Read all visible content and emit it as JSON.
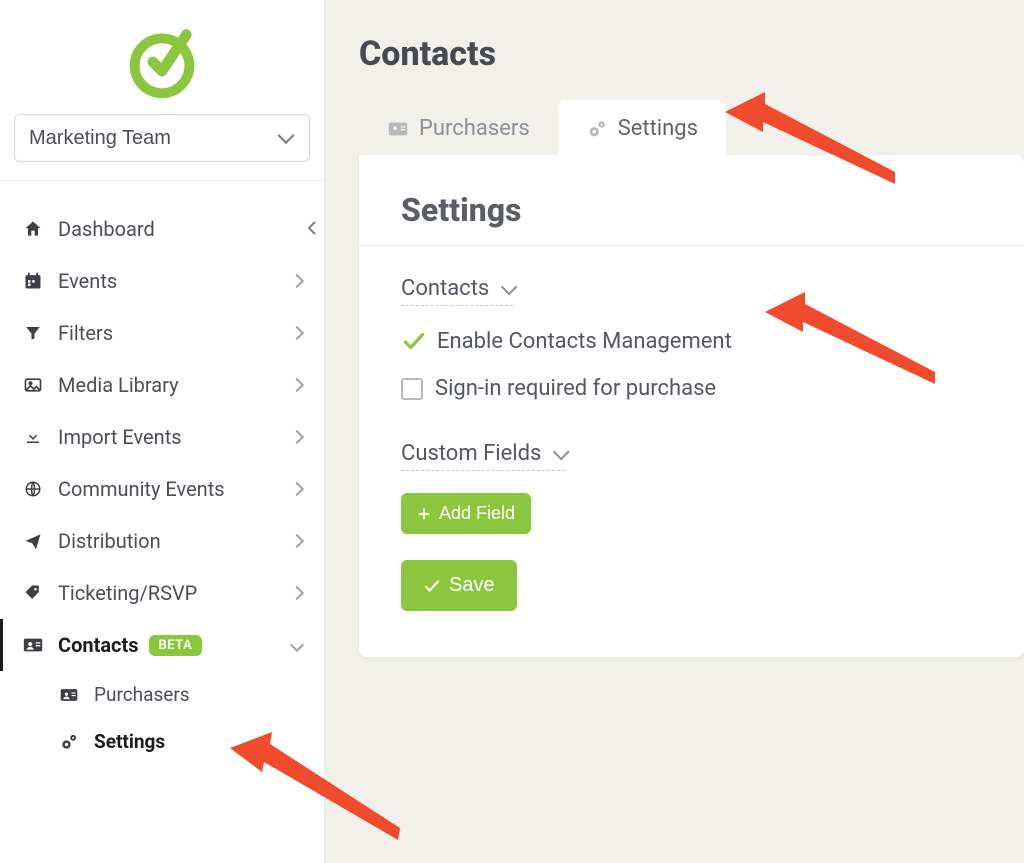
{
  "sidebar": {
    "team_selected": "Marketing Team",
    "items": [
      {
        "icon": "home",
        "label": "Dashboard",
        "expandable": false
      },
      {
        "icon": "calendar",
        "label": "Events",
        "expandable": true
      },
      {
        "icon": "filter",
        "label": "Filters",
        "expandable": true
      },
      {
        "icon": "image",
        "label": "Media Library",
        "expandable": true
      },
      {
        "icon": "download",
        "label": "Import Events",
        "expandable": true
      },
      {
        "icon": "globe",
        "label": "Community Events",
        "expandable": true
      },
      {
        "icon": "send",
        "label": "Distribution",
        "expandable": true
      },
      {
        "icon": "tag",
        "label": "Ticketing/RSVP",
        "expandable": true
      },
      {
        "icon": "id-card",
        "label": "Contacts",
        "expandable": true,
        "badge": "BETA",
        "active": true
      }
    ],
    "subitems": [
      {
        "icon": "id-card",
        "label": "Purchasers"
      },
      {
        "icon": "gear",
        "label": "Settings",
        "active": true
      }
    ]
  },
  "main": {
    "page_title": "Contacts",
    "tabs": [
      {
        "icon": "id-card",
        "label": "Purchasers",
        "active": false
      },
      {
        "icon": "gear",
        "label": "Settings",
        "active": true
      }
    ],
    "panel": {
      "title": "Settings",
      "section_contacts": "Contacts",
      "opt_enable": "Enable Contacts Management",
      "opt_signin": "Sign-in required for purchase",
      "section_custom": "Custom Fields",
      "add_field": "Add Field",
      "save": "Save"
    }
  },
  "colors": {
    "accent": "#8cc63f"
  }
}
